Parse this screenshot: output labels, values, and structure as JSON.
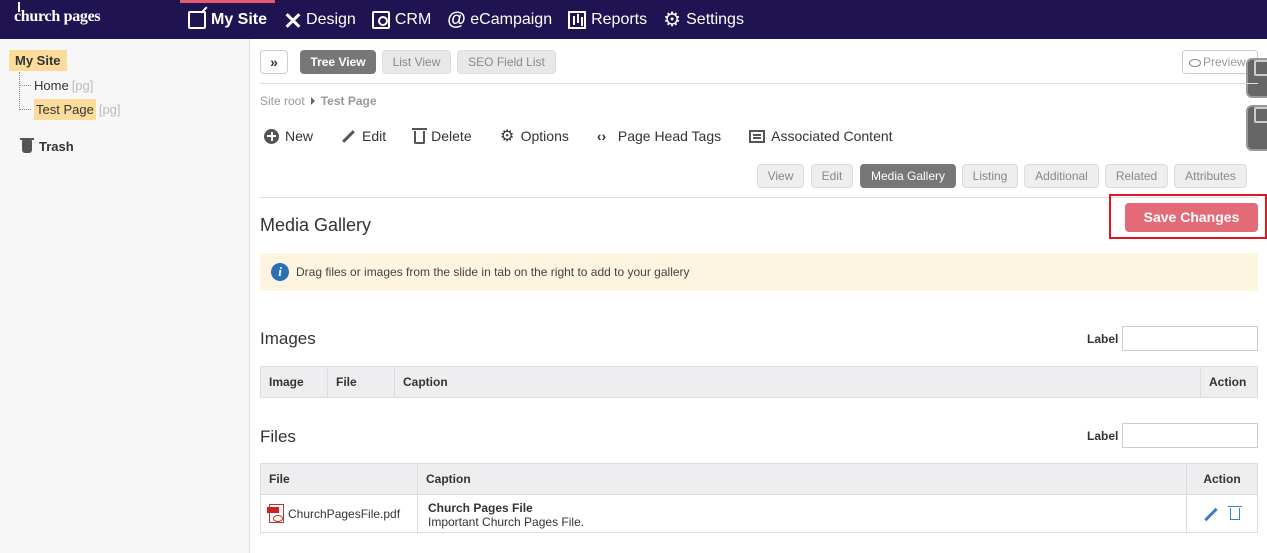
{
  "brand": {
    "logo_text": "church pages"
  },
  "nav": {
    "items": [
      {
        "label": "My Site",
        "icon": "site-icon",
        "active": true
      },
      {
        "label": "Design",
        "icon": "design-icon"
      },
      {
        "label": "CRM",
        "icon": "crm-icon"
      },
      {
        "label": "eCampaign",
        "icon": "at-icon"
      },
      {
        "label": "Reports",
        "icon": "reports-icon"
      },
      {
        "label": "Settings",
        "icon": "gear-icon"
      }
    ]
  },
  "sidebar": {
    "root": "My Site",
    "items": [
      {
        "label": "Home",
        "suffix": "[pg]"
      },
      {
        "label": "Test Page",
        "suffix": "[pg]",
        "selected": true
      }
    ],
    "trash": "Trash"
  },
  "view_tabs": [
    {
      "label": "Tree View",
      "active": true
    },
    {
      "label": "List View"
    },
    {
      "label": "SEO Field List"
    }
  ],
  "expand_label": "»",
  "preview_label": "Preview",
  "breadcrumb": {
    "root": "Site root",
    "current": "Test Page"
  },
  "toolbar": {
    "items": [
      {
        "label": "New",
        "icon": "plus-circle-icon"
      },
      {
        "label": "Edit",
        "icon": "pencil-icon"
      },
      {
        "label": "Delete",
        "icon": "trash-icon"
      },
      {
        "label": "Options",
        "icon": "gear-icon"
      },
      {
        "label": "Page Head Tags",
        "icon": "code-icon"
      },
      {
        "label": "Associated Content",
        "icon": "list-box-icon"
      }
    ]
  },
  "sub_tabs": [
    {
      "label": "View"
    },
    {
      "label": "Edit"
    },
    {
      "label": "Media Gallery",
      "active": true
    },
    {
      "label": "Listing"
    },
    {
      "label": "Additional"
    },
    {
      "label": "Related"
    },
    {
      "label": "Attributes"
    }
  ],
  "media_gallery": {
    "title": "Media Gallery",
    "save_label": "Save Changes",
    "info_text": "Drag files or images from the slide in tab on the right to add to your gallery",
    "images": {
      "title": "Images",
      "label_text": "Label",
      "columns": [
        "Image",
        "File",
        "Caption",
        "Action"
      ]
    },
    "files": {
      "title": "Files",
      "label_text": "Label",
      "columns": [
        "File",
        "Caption",
        "Action"
      ],
      "rows": [
        {
          "file": "ChurchPagesFile.pdf",
          "caption_title": "Church Pages File",
          "caption_desc": "Important Church Pages File."
        }
      ]
    }
  },
  "colors": {
    "topbar": "#1f1352",
    "nav_active_accent": "#e15b6c",
    "tree_highlight": "#fbdc9a",
    "save_button": "#e36b78",
    "highlight_outline": "#e0151f",
    "info_bg": "#fdf5e0",
    "action_icon": "#3a7ec9"
  }
}
